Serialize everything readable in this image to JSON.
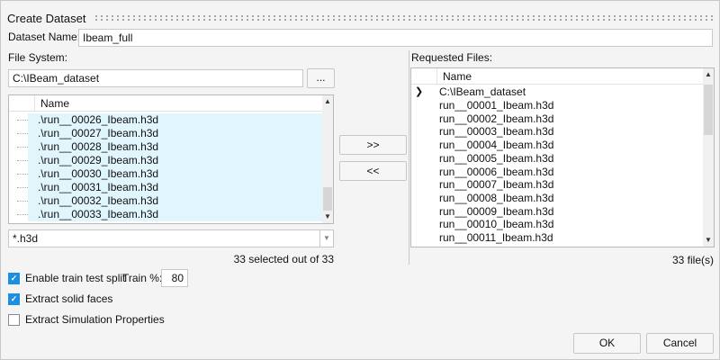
{
  "window": {
    "title": "Create Dataset"
  },
  "dataset_name": {
    "label": "Dataset Name:",
    "value": "Ibeam_full"
  },
  "file_system": {
    "label": "File System:",
    "path": "C:\\IBeam_dataset",
    "browse_label": "...",
    "column_header": "Name",
    "files": [
      ".\\run__00026_Ibeam.h3d",
      ".\\run__00027_Ibeam.h3d",
      ".\\run__00028_Ibeam.h3d",
      ".\\run__00029_Ibeam.h3d",
      ".\\run__00030_Ibeam.h3d",
      ".\\run__00031_Ibeam.h3d",
      ".\\run__00032_Ibeam.h3d",
      ".\\run__00033_Ibeam.h3d"
    ],
    "filter": "*.h3d",
    "selection_status": "33 selected out of 33"
  },
  "transfer": {
    "add_label": ">>",
    "remove_label": "<<"
  },
  "requested": {
    "label": "Requested Files:",
    "column_header": "Name",
    "root": "C:\\IBeam_dataset",
    "files": [
      "run__00001_Ibeam.h3d",
      "run__00002_Ibeam.h3d",
      "run__00003_Ibeam.h3d",
      "run__00004_Ibeam.h3d",
      "run__00005_Ibeam.h3d",
      "run__00006_Ibeam.h3d",
      "run__00007_Ibeam.h3d",
      "run__00008_Ibeam.h3d",
      "run__00009_Ibeam.h3d",
      "run__00010_Ibeam.h3d",
      "run__00011_Ibeam.h3d"
    ],
    "count": "33 file(s)"
  },
  "options": {
    "train_split": {
      "label": "Enable train test split",
      "checked": true
    },
    "train_pct": {
      "label": "Train %:",
      "value": "80"
    },
    "solid_faces": {
      "label": "Extract solid faces",
      "checked": true
    },
    "sim_props": {
      "label": "Extract Simulation Properties",
      "checked": false
    }
  },
  "footer": {
    "ok": "OK",
    "cancel": "Cancel"
  },
  "colors": {
    "accent": "#1d8fe0",
    "selection": "#e1f5fd"
  }
}
